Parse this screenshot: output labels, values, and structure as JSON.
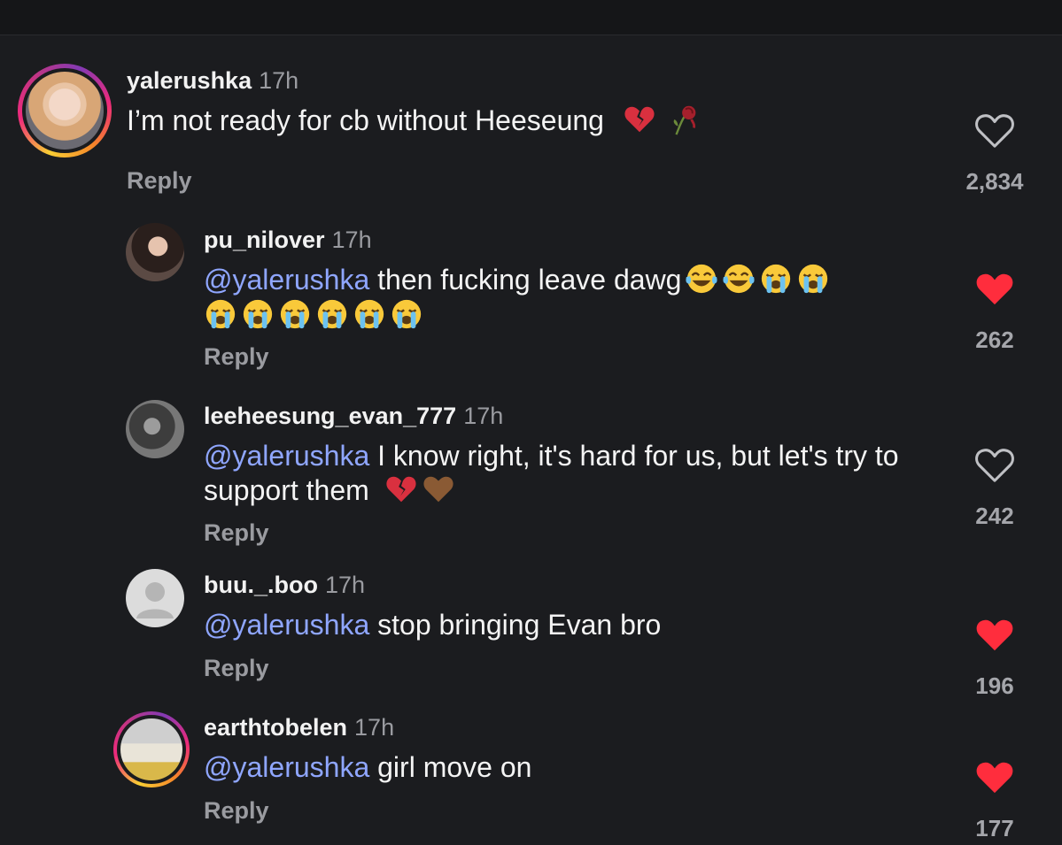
{
  "comments": [
    {
      "username": "yalerushka",
      "time": "17h",
      "mention": "",
      "text": "I’m not ready for cb without Heeseung",
      "emoji_icons": [
        "broken-heart-icon",
        "wilted-rose-icon"
      ],
      "reply_label": "Reply",
      "likes": "2,834",
      "liked": false,
      "story_ring": true
    },
    {
      "username": "pu_nilover",
      "time": "17h",
      "mention": "@yalerushka",
      "text": "then fucking leave dawg",
      "emoji_icons": [
        "tears-of-joy-icon",
        "tears-of-joy-icon",
        "loudly-crying-icon",
        "loudly-crying-icon",
        "loudly-crying-icon",
        "loudly-crying-icon",
        "loudly-crying-icon",
        "loudly-crying-icon",
        "loudly-crying-icon",
        "loudly-crying-icon"
      ],
      "reply_label": "Reply",
      "likes": "262",
      "liked": true,
      "story_ring": false
    },
    {
      "username": "leeheesung_evan_777",
      "time": "17h",
      "mention": "@yalerushka",
      "text": "I know right, it's hard for us, but let's try to support them",
      "emoji_icons": [
        "broken-heart-icon",
        "brown-heart-icon"
      ],
      "reply_label": "Reply",
      "likes": "242",
      "liked": false,
      "story_ring": false
    },
    {
      "username": "buu._.boo",
      "time": "17h",
      "mention": "@yalerushka",
      "text": "stop bringing Evan bro",
      "emoji_icons": [],
      "reply_label": "Reply",
      "likes": "196",
      "liked": true,
      "story_ring": false
    },
    {
      "username": "earthtobelen",
      "time": "17h",
      "mention": "@yalerushka",
      "text": "girl move on",
      "emoji_icons": [],
      "reply_label": "Reply",
      "likes": "177",
      "liked": true,
      "story_ring": true
    }
  ],
  "colors": {
    "background": "#1b1c1f",
    "mention": "#8fa6ff",
    "liked_heart": "#ff2d3d",
    "muted_text": "#9a9ba0"
  }
}
